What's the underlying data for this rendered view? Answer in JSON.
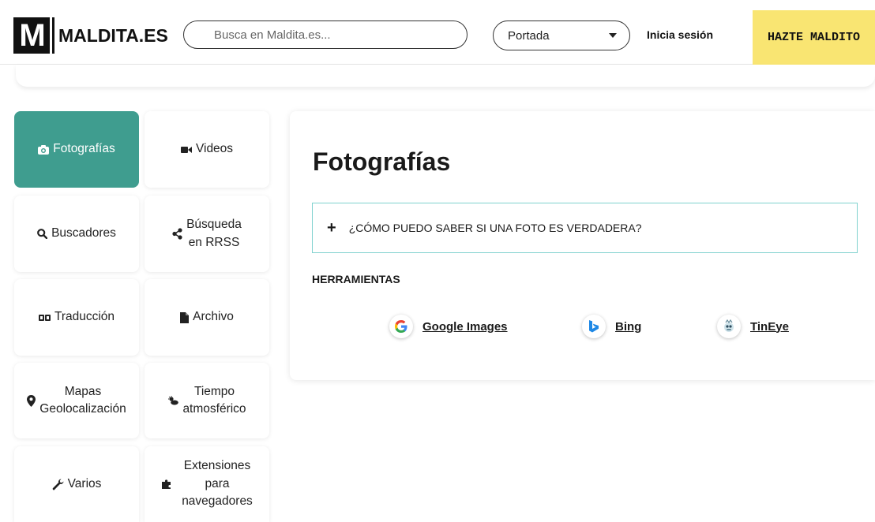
{
  "header": {
    "logo_letter": "M",
    "logo_text": "MALDITA.ES",
    "search_placeholder": "Busca en Maldita.es...",
    "section_select": "Portada",
    "login_label": "Inicia sesión",
    "join_label": "HAZTE MALDITO"
  },
  "nav": {
    "items": [
      {
        "label": "Fotografías",
        "icon": "camera-icon"
      },
      {
        "label": "Videos",
        "icon": "video-camera-icon"
      },
      {
        "label": "Buscadores",
        "icon": "search-icon"
      },
      {
        "label_1": "Búsqueda",
        "label_2": "en RRSS",
        "icon": "share-icon"
      },
      {
        "label": "Traducción",
        "icon": "translate-icon"
      },
      {
        "label": "Archivo",
        "icon": "file-icon"
      },
      {
        "label_1": "Mapas",
        "label_2": "Geolocalización",
        "icon": "map-marker-icon"
      },
      {
        "label_1": "Tiempo",
        "label_2": "atmosférico",
        "icon": "weather-icon"
      },
      {
        "label": "Varios",
        "icon": "wrench-icon"
      },
      {
        "label_1": "Extensiones",
        "label_2": "para",
        "label_3": "navegadores",
        "icon": "puzzle-icon"
      }
    ]
  },
  "main": {
    "title": "Fotografías",
    "accordion_toggle": "+",
    "accordion_question": "¿CÓMO PUEDO SABER SI UNA FOTO ES VERDADERA?",
    "tools_heading": "HERRAMIENTAS",
    "tools": [
      {
        "name": "Google Images",
        "icon": "google-icon"
      },
      {
        "name": "Bing",
        "icon": "bing-icon"
      },
      {
        "name": "TinEye",
        "icon": "tineye-icon"
      }
    ]
  },
  "colors": {
    "active_tile": "#3f9d8f",
    "join_button": "#f9e572",
    "accordion_border": "#7fd1ce",
    "google_blue": "#4285f4",
    "bing_blue": "#1e88e5"
  }
}
